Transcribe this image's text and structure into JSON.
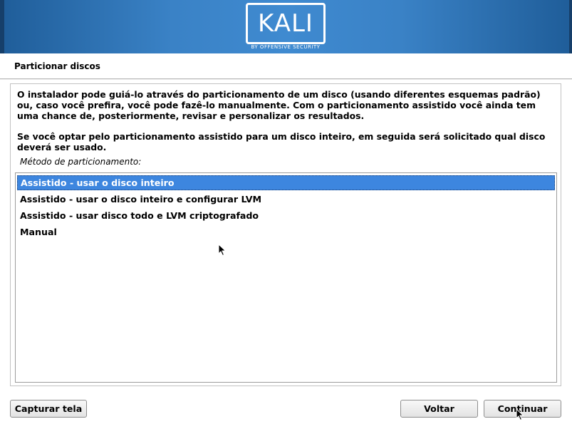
{
  "banner": {
    "logo_text": "KALI",
    "logo_subtext": "BY OFFENSIVE SECURITY",
    "colors": {
      "banner_blue": "#3a82c6",
      "banner_dark": "#1f5d99"
    }
  },
  "page": {
    "title": "Particionar discos"
  },
  "content": {
    "paragraph_1": "O instalador pode guiá-lo através do particionamento de um disco (usando diferentes esquemas padrão) ou, caso você prefira, você pode fazê-lo manualmente. Com o particionamento assistido você ainda tem uma chance de, posteriormente, revisar e personalizar os resultados.",
    "paragraph_2": "Se você optar pelo particionamento assistido para um disco inteiro, em seguida será solicitado qual disco deverá ser usado.",
    "prompt_label": "Método de particionamento:"
  },
  "partition_methods": {
    "items": [
      {
        "label": "Assistido - usar o disco inteiro",
        "selected": true
      },
      {
        "label": "Assistido - usar o disco inteiro e configurar LVM",
        "selected": false
      },
      {
        "label": "Assistido - usar disco todo e LVM criptografado",
        "selected": false
      },
      {
        "label": "Manual",
        "selected": false
      }
    ],
    "selection_color": "#3d86df"
  },
  "buttons": {
    "screenshot_label": "Capturar tela",
    "back_label": "Voltar",
    "continue_label": "Continuar"
  },
  "icons": {
    "pointer": "mouse-pointer-icon"
  }
}
